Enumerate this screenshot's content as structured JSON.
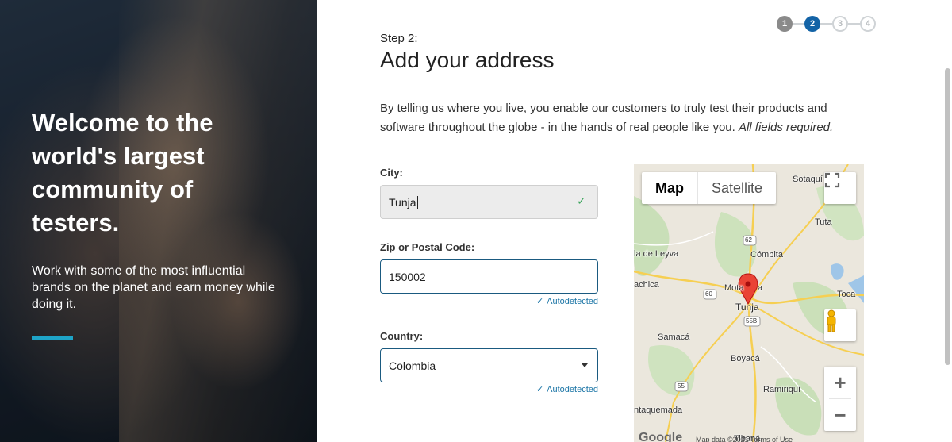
{
  "hero": {
    "title": "Welcome to the world's largest community of testers.",
    "subtitle": "Work with some of the most influential brands on the planet and earn money while doing it."
  },
  "steps": [
    "1",
    "2",
    "3",
    "4"
  ],
  "form": {
    "step_label": "Step 2:",
    "title": "Add your address",
    "intro": "By telling us where you live, you enable our customers to truly test their products and software throughout the globe - in the hands of real people like you.",
    "intro_em": "All fields required.",
    "city_label": "City:",
    "city_value": "Tunja",
    "zip_label": "Zip or Postal Code:",
    "zip_value": "150002",
    "zip_note": "Autodetected",
    "country_label": "Country:",
    "country_value": "Colombia",
    "country_note": "Autodetected"
  },
  "map": {
    "tab_map": "Map",
    "tab_satellite": "Satellite",
    "places": {
      "sotaquira": "Sotaquí",
      "tuta": "Tuta",
      "villa_leyva": "la de Leyva",
      "combita": "Cómbita",
      "chiquinquira": "achica",
      "motavita": "Mota",
      "motavita_tail": "a",
      "tunja": "Tunja",
      "toca": "Toca",
      "samaca": "Samacá",
      "boyaca": "Boyacá",
      "ramiriqui": "Ramiriquí",
      "chiquiza": "ntaquemada",
      "tibana": "Tibaná"
    },
    "routes": [
      "62",
      "60",
      "55B",
      "55"
    ],
    "logo": "Google",
    "footer": "Map data ©2021   Terms of Use"
  }
}
